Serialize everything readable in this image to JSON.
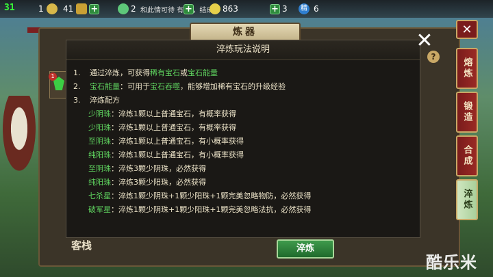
{
  "status": {
    "fps": "31"
  },
  "resources": [
    {
      "value": "1",
      "icon": "yuanbao-icon"
    },
    {
      "value": "41",
      "icon": "gold-ingot-icon"
    },
    {
      "value": "2",
      "icon": "jade-icon"
    },
    {
      "value": "863",
      "icon": "coin-icon"
    },
    {
      "value": "3",
      "icon": "orb-icon"
    },
    {
      "value": "6",
      "icon": "essence-icon",
      "label": "精"
    }
  ],
  "ticker": "和此情可待  有灵  ，结成了",
  "window": {
    "title": "炼器"
  },
  "tabs": [
    {
      "label": "熔炼",
      "active": false
    },
    {
      "label": "锻造",
      "active": false
    },
    {
      "label": "合成",
      "active": false
    },
    {
      "label": "淬炼",
      "active": true
    }
  ],
  "dialog": {
    "title": "淬炼玩法说明",
    "lines": [
      {
        "num": "1.",
        "pre": "通过淬炼，可获得",
        "hl1": "稀有宝石",
        "mid": "或",
        "hl2": "宝石能量"
      },
      {
        "num": "2.",
        "hl0": "宝石能量",
        "pre": "：可用于",
        "hl1": "宝石吞噬",
        "post": "，能够增加稀有宝石的升级经验"
      },
      {
        "num": "3.",
        "pre": "淬炼配方"
      }
    ],
    "recipes": [
      {
        "name": "少阴珠",
        "desc": "：淬炼1颗以上普通宝石，有概率获得"
      },
      {
        "name": "少阳珠",
        "desc": "：淬炼1颗以上普通宝石，有概率获得"
      },
      {
        "name": "至阴珠",
        "desc": "：淬炼1颗以上普通宝石，有小概率获得"
      },
      {
        "name": "纯阳珠",
        "desc": "：淬炼1颗以上普通宝石，有小概率获得"
      },
      {
        "name": "至阴珠",
        "desc": "：淬炼3颗少阴珠，必然获得"
      },
      {
        "name": "纯阳珠",
        "desc": "：淬炼3颗少阳珠，必然获得"
      },
      {
        "name": "七杀星",
        "desc": "：淬炼1颗少阴珠+1颗少阳珠+1颗完美忽略物防，必然获得"
      },
      {
        "name": "破军星",
        "desc": "：淬炼1颗少阴珠+1颗少阳珠+1颗完美忽略法抗，必然获得"
      }
    ]
  },
  "action_button": "淬炼",
  "item_badge": "1",
  "watermark": "酷乐米",
  "stamp_text": "客栈"
}
